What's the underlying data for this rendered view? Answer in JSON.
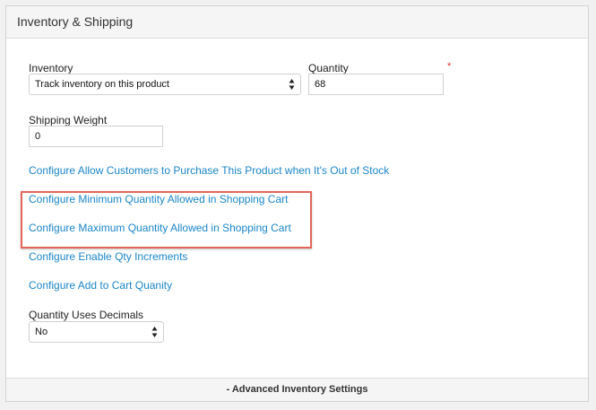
{
  "panel": {
    "title": "Inventory & Shipping"
  },
  "inventory": {
    "label": "Inventory",
    "selected": "Track inventory on this product"
  },
  "quantity": {
    "label": "Quantity",
    "required_mark": "*",
    "value": "68"
  },
  "shipping_weight": {
    "label": "Shipping Weight",
    "value": "0"
  },
  "links": {
    "out_of_stock": "Configure Allow Customers to Purchase This Product when It's Out of Stock",
    "min_qty": "Configure Minimum Quantity Allowed in Shopping Cart",
    "max_qty": "Configure Maximum Quantity Allowed in Shopping Cart",
    "qty_increments": "Configure Enable Qty Increments",
    "add_to_cart_qty": "Configure Add to Cart Quanity"
  },
  "qty_decimals": {
    "label": "Quantity Uses Decimals",
    "selected": "No"
  },
  "footer": {
    "toggle_label": "- Advanced Inventory Settings"
  },
  "colors": {
    "link": "#1a86c8",
    "required": "#d9342b",
    "highlight": "#e2675a"
  },
  "icons": {
    "select_arrows": "updown-arrows-icon"
  }
}
